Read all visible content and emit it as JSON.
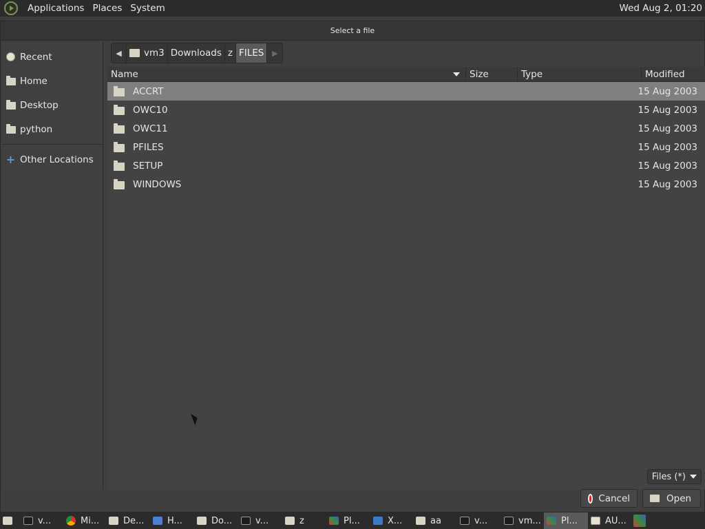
{
  "top_panel": {
    "menus": [
      "Applications",
      "Places",
      "System"
    ],
    "clock": "Wed Aug  2, 01:20"
  },
  "dialog": {
    "title": "Select a file",
    "sidebar": [
      {
        "label": "Recent",
        "icon": "recent-icon"
      },
      {
        "label": "Home",
        "icon": "home-icon"
      },
      {
        "label": "Desktop",
        "icon": "desktop-icon"
      },
      {
        "label": "python",
        "icon": "folder-icon"
      }
    ],
    "sidebar_other": {
      "label": "Other Locations",
      "icon": "plus-icon"
    },
    "pathbar": [
      "vm3",
      "Downloads",
      "z",
      "FILES"
    ],
    "columns": {
      "name": "Name",
      "size": "Size",
      "type": "Type",
      "modified": "Modified"
    },
    "files": [
      {
        "name": "ACCRT",
        "modified": "15 Aug 2003",
        "selected": true
      },
      {
        "name": "OWC10",
        "modified": "15 Aug 2003"
      },
      {
        "name": "OWC11",
        "modified": "15 Aug 2003"
      },
      {
        "name": "PFILES",
        "modified": "15 Aug 2003"
      },
      {
        "name": "SETUP",
        "modified": "15 Aug 2003"
      },
      {
        "name": "WINDOWS",
        "modified": "15 Aug 2003"
      }
    ],
    "filter": "Files (*)",
    "cancel_label": "Cancel",
    "open_label": "Open"
  },
  "taskbar": [
    {
      "label": "v...",
      "icon": "terminal-icon"
    },
    {
      "label": "Mi...",
      "icon": "chrome-icon"
    },
    {
      "label": "De...",
      "icon": "folder-icon"
    },
    {
      "label": "H...",
      "icon": "document-icon"
    },
    {
      "label": "Do...",
      "icon": "folder-icon"
    },
    {
      "label": "v...",
      "icon": "terminal-icon"
    },
    {
      "label": "z",
      "icon": "folder-icon"
    },
    {
      "label": "Pl...",
      "icon": "paint-icon"
    },
    {
      "label": "X...",
      "icon": "x-icon"
    },
    {
      "label": "aa",
      "icon": "folder-icon"
    },
    {
      "label": "v...",
      "icon": "terminal-icon"
    },
    {
      "label": "vm...",
      "icon": "terminal-icon"
    },
    {
      "label": "Pl...",
      "icon": "paint-icon",
      "active": true
    },
    {
      "label": "AU...",
      "icon": "editor-icon"
    }
  ]
}
